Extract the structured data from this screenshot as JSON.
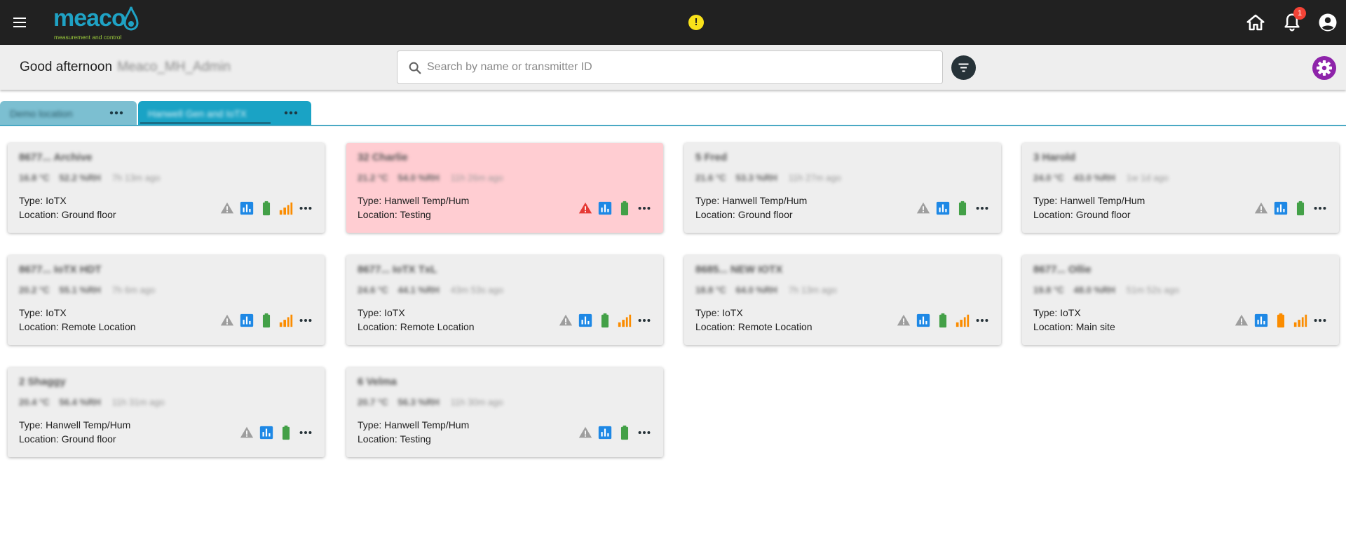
{
  "app": {
    "logo_text": "meaco",
    "logo_tagline": "measurement and control",
    "alert_symbol": "!",
    "notification_count": "1",
    "brand_color": "#1fa2c4"
  },
  "header": {
    "greeting": "Good afternoon",
    "username": "Meaco_MH_Admin",
    "search_placeholder": "Search by name or transmitter ID"
  },
  "tabs": [
    {
      "label": "Demo location"
    },
    {
      "label": "Hanwell Gen and IoTX"
    }
  ],
  "cards": [
    {
      "title": "8677... Archive",
      "temp": "16.8 °C",
      "hum": "52.2 %RH",
      "ago": "7h 13m ago",
      "type": "Type: IoTX",
      "location": "Location: Ground floor",
      "alarm": false,
      "warning_color": "#9e9e9e",
      "battery_color": "#43a047",
      "signal": true
    },
    {
      "title": "32 Charlie",
      "temp": "21.2 °C",
      "hum": "54.0 %RH",
      "ago": "11h 26m ago",
      "type": "Type: Hanwell Temp/Hum",
      "location": "Location: Testing",
      "alarm": true,
      "warning_color": "#e53935",
      "battery_color": "#43a047",
      "signal": false
    },
    {
      "title": "5 Fred",
      "temp": "21.6 °C",
      "hum": "53.3 %RH",
      "ago": "11h 27m ago",
      "type": "Type: Hanwell Temp/Hum",
      "location": "Location: Ground floor",
      "alarm": false,
      "warning_color": "#9e9e9e",
      "battery_color": "#43a047",
      "signal": false
    },
    {
      "title": "3 Harold",
      "temp": "24.0 °C",
      "hum": "43.0 %RH",
      "ago": "1w 1d ago",
      "type": "Type: Hanwell Temp/Hum",
      "location": "Location: Ground floor",
      "alarm": false,
      "warning_color": "#9e9e9e",
      "battery_color": "#43a047",
      "signal": false
    },
    {
      "title": "8677... IoTX HDT",
      "temp": "20.2 °C",
      "hum": "55.1 %RH",
      "ago": "7h 6m ago",
      "type": "Type: IoTX",
      "location": "Location: Remote Location",
      "alarm": false,
      "warning_color": "#9e9e9e",
      "battery_color": "#43a047",
      "signal": true
    },
    {
      "title": "8677... IoTX TxL",
      "temp": "24.6 °C",
      "hum": "44.1 %RH",
      "ago": "43m 53s ago",
      "type": "Type: IoTX",
      "location": "Location: Remote Location",
      "alarm": false,
      "warning_color": "#9e9e9e",
      "battery_color": "#43a047",
      "signal": true
    },
    {
      "title": "8685... NEW IOTX",
      "temp": "18.8 °C",
      "hum": "64.0 %RH",
      "ago": "7h 13m ago",
      "type": "Type: IoTX",
      "location": "Location: Remote Location",
      "alarm": false,
      "warning_color": "#9e9e9e",
      "battery_color": "#43a047",
      "signal": true
    },
    {
      "title": "8677... Ollie",
      "temp": "19.8 °C",
      "hum": "48.0 %RH",
      "ago": "51m 52s ago",
      "type": "Type: IoTX",
      "location": "Location: Main site",
      "alarm": false,
      "warning_color": "#9e9e9e",
      "battery_color": "#fb8c00",
      "signal": true
    },
    {
      "title": "2 Shaggy",
      "temp": "20.4 °C",
      "hum": "56.4 %RH",
      "ago": "11h 31m ago",
      "type": "Type: Hanwell Temp/Hum",
      "location": "Location: Ground floor",
      "alarm": false,
      "warning_color": "#9e9e9e",
      "battery_color": "#43a047",
      "signal": false
    },
    {
      "title": "6 Velma",
      "temp": "20.7 °C",
      "hum": "56.3 %RH",
      "ago": "11h 30m ago",
      "type": "Type: Hanwell Temp/Hum",
      "location": "Location: Testing",
      "alarm": false,
      "warning_color": "#9e9e9e",
      "battery_color": "#43a047",
      "signal": false
    }
  ]
}
